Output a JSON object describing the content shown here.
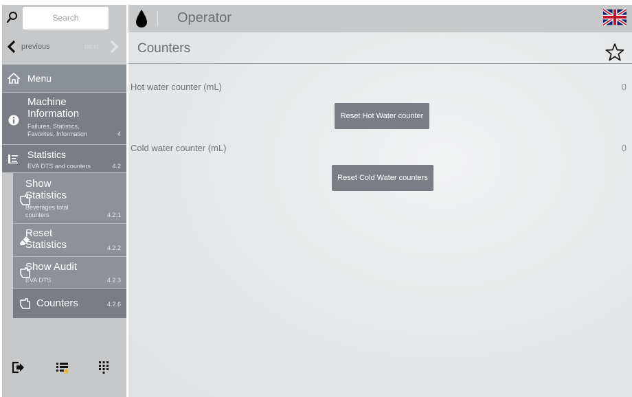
{
  "search": {
    "placeholder": "Search"
  },
  "nav": {
    "previous": "previous",
    "next": "next"
  },
  "sidebar": {
    "menu": {
      "label": "Menu"
    },
    "machine_information": {
      "title_line1": "Machine",
      "title_line2": "Information",
      "sub_line1": "Failures, Statistics,",
      "sub_line2": "Favorites, Information",
      "number": "4"
    },
    "statistics": {
      "title": "Statistics",
      "sub": "EVA DTS and counters",
      "number": "4.2"
    },
    "items": [
      {
        "title_line1": "Show",
        "title_line2": "Statistics",
        "sub_line1": "Beverages total",
        "sub_line2": "counters",
        "number": "4.2.1"
      },
      {
        "title_line1": "Reset",
        "title_line2": "Statistics",
        "number": "4.2.2"
      },
      {
        "title_line1": "Show Audit",
        "sub_line1": "EVA DTS",
        "number": "4.2.3"
      },
      {
        "title_line1": "Counters",
        "number": "4.2.6"
      }
    ]
  },
  "header": {
    "title": "Operator"
  },
  "page": {
    "title": "Counters"
  },
  "counters": {
    "hot": {
      "label": "Hot water counter (mL)",
      "value": "0",
      "reset_label": "Reset Hot Water counter"
    },
    "cold": {
      "label": "Cold water counter (mL)",
      "value": "0",
      "reset_label": "Reset Cold Water counters"
    }
  },
  "colors": {
    "sidebar_bg": "#c6c8ca",
    "sidebar_active": "#7a7e84",
    "button": "#7a7e84",
    "main_bg": "#e6e8ea"
  },
  "icons": [
    "search-icon",
    "chevron-left-icon",
    "chevron-right-icon",
    "home-icon",
    "info-icon",
    "statistics-icon",
    "hand-pointer-icon",
    "eraser-icon",
    "drop-icon",
    "flag-uk-icon",
    "star-icon",
    "logout-icon",
    "list-star-icon",
    "keypad-icon"
  ]
}
